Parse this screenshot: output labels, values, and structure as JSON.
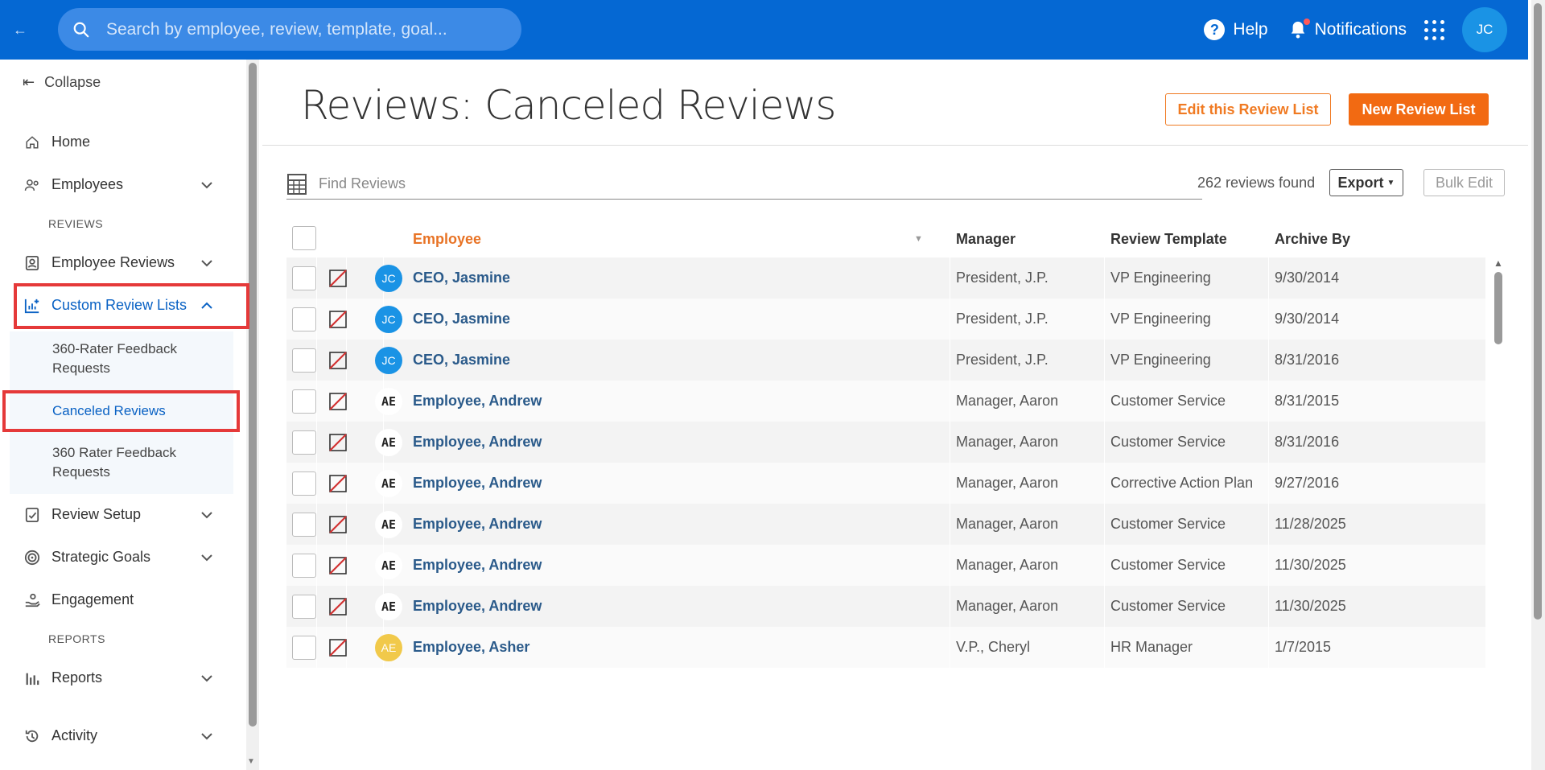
{
  "topbar": {
    "back_icon": "arrow-left-icon",
    "search_placeholder": "Search by employee, review, template, goal...",
    "help_label": "Help",
    "notifications_label": "Notifications",
    "user_initials": "JC"
  },
  "sidebar": {
    "collapse_label": "Collapse",
    "items": [
      {
        "label": "Home",
        "icon": "home-icon"
      },
      {
        "label": "Employees",
        "icon": "people-icon"
      },
      {
        "label": "Employee Reviews",
        "icon": "badge-icon"
      },
      {
        "label": "Custom Review Lists",
        "icon": "chart-plus-icon"
      },
      {
        "label": "Review Setup",
        "icon": "clipboard-icon"
      },
      {
        "label": "Strategic Goals",
        "icon": "target-icon"
      },
      {
        "label": "Engagement",
        "icon": "hand-icon"
      },
      {
        "label": "Reports",
        "icon": "bar-chart-icon"
      },
      {
        "label": "Activity",
        "icon": "history-icon"
      }
    ],
    "section_reviews": "REVIEWS",
    "section_reports": "REPORTS",
    "sub_items": [
      "360-Rater Feedback Requests",
      "Canceled Reviews",
      "360 Rater Feedback Requests"
    ],
    "highlight_color": "#e53939"
  },
  "main": {
    "title": "Reviews: Canceled Reviews",
    "edit_button": "Edit this Review List",
    "new_button": "New Review List",
    "find_placeholder": "Find Reviews",
    "found_text": "262 reviews found",
    "export_button": "Export",
    "bulk_edit_button": "Bulk Edit"
  },
  "table": {
    "columns": [
      "Employee",
      "Manager",
      "Review Template",
      "Archive By"
    ],
    "rows": [
      {
        "initials": "JC",
        "avatar": "blue",
        "employee": "CEO, Jasmine",
        "manager": "President, J.P.",
        "template": "VP Engineering",
        "archive_by": "9/30/2014"
      },
      {
        "initials": "JC",
        "avatar": "blue",
        "employee": "CEO, Jasmine",
        "manager": "President, J.P.",
        "template": "VP Engineering",
        "archive_by": "9/30/2014"
      },
      {
        "initials": "JC",
        "avatar": "blue",
        "employee": "CEO, Jasmine",
        "manager": "President, J.P.",
        "template": "VP Engineering",
        "archive_by": "8/31/2016"
      },
      {
        "initials": "AE",
        "avatar": "white",
        "employee": "Employee, Andrew",
        "manager": "Manager, Aaron",
        "template": "Customer Service",
        "archive_by": "8/31/2015"
      },
      {
        "initials": "AE",
        "avatar": "white",
        "employee": "Employee, Andrew",
        "manager": "Manager, Aaron",
        "template": "Customer Service",
        "archive_by": "8/31/2016"
      },
      {
        "initials": "AE",
        "avatar": "white",
        "employee": "Employee, Andrew",
        "manager": "Manager, Aaron",
        "template": "Corrective Action Plan",
        "archive_by": "9/27/2016"
      },
      {
        "initials": "AE",
        "avatar": "white",
        "employee": "Employee, Andrew",
        "manager": "Manager, Aaron",
        "template": "Customer Service",
        "archive_by": "11/28/2025"
      },
      {
        "initials": "AE",
        "avatar": "white",
        "employee": "Employee, Andrew",
        "manager": "Manager, Aaron",
        "template": "Customer Service",
        "archive_by": "11/30/2025"
      },
      {
        "initials": "AE",
        "avatar": "white",
        "employee": "Employee, Andrew",
        "manager": "Manager, Aaron",
        "template": "Customer Service",
        "archive_by": "11/30/2025"
      },
      {
        "initials": "AE",
        "avatar": "yellow",
        "employee": "Employee, Asher",
        "manager": "V.P., Cheryl",
        "template": "HR Manager",
        "archive_by": "1/7/2015"
      }
    ]
  },
  "colors": {
    "brand_blue": "#0568d3",
    "accent_orange": "#f26a12",
    "link_blue": "#2a5a8a"
  }
}
